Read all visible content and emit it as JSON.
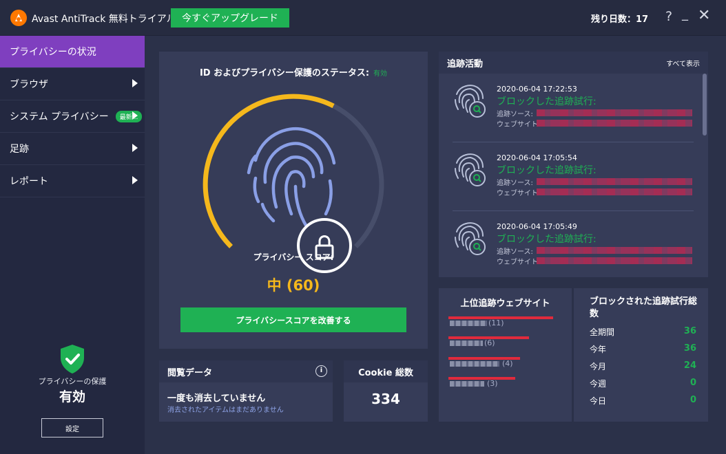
{
  "titlebar": {
    "app_title": "Avast AntiTrack 無料トライアル",
    "upgrade_label": "今すぐアップグレード",
    "days_left": "残り日数：17",
    "help_icon": "?",
    "minimize_icon": "_",
    "close_icon": "✕"
  },
  "sidebar": {
    "items": [
      {
        "label": "プライバシーの状況"
      },
      {
        "label": "ブラウザ"
      },
      {
        "label": "システム プライバシー",
        "badge": "最新..."
      },
      {
        "label": "足跡"
      },
      {
        "label": "レポート"
      }
    ],
    "protection_label": "プライバシーの保護",
    "protection_status": "有効",
    "settings_label": "設定"
  },
  "status_panel": {
    "title": "ID およびプライバシー保護のステータス:",
    "status": "有効",
    "score_label": "プライバシー スコア:",
    "score_value": "中 (60)",
    "score_fraction": 0.6,
    "improve_label": "プライバシースコアを改善する"
  },
  "browse_panel": {
    "title": "閲覧データ",
    "main": "一度も消去していません",
    "sub": "消去されたアイテムはまだありません"
  },
  "cookie_panel": {
    "title": "Cookie 総数",
    "value": "334"
  },
  "tracking": {
    "title": "追跡活動",
    "show_all": "すべて表示",
    "entries": [
      {
        "time": "2020-06-04 17:22:53",
        "status": "ブロックした追跡試行:",
        "source_label": "追跡ソース:",
        "site_label": "ウェブサイト"
      },
      {
        "time": "2020-06-04 17:05:54",
        "status": "ブロックした追跡試行:",
        "source_label": "追跡ソース:",
        "site_label": "ウェブサイト"
      },
      {
        "time": "2020-06-04 17:05:49",
        "status": "ブロックした追跡試行:",
        "source_label": "追跡ソース:",
        "site_label": "ウェブサイト"
      }
    ]
  },
  "top_sites": {
    "title": "上位追跡ウェブサイト",
    "items": [
      {
        "count": "(11)"
      },
      {
        "count": "(6)"
      },
      {
        "count": "(4)"
      },
      {
        "count": "(3)"
      }
    ]
  },
  "blocked": {
    "title": "ブロックされた追跡試行総数",
    "rows": [
      {
        "label": "全期間",
        "value": "36"
      },
      {
        "label": "今年",
        "value": "36"
      },
      {
        "label": "今月",
        "value": "24"
      },
      {
        "label": "今週",
        "value": "0"
      },
      {
        "label": "今日",
        "value": "0"
      }
    ]
  },
  "colors": {
    "accent_green": "#1fb154",
    "active_purple": "#7f3fbf",
    "gauge_yellow": "#f5b81c",
    "logo_orange": "#ff7800"
  }
}
